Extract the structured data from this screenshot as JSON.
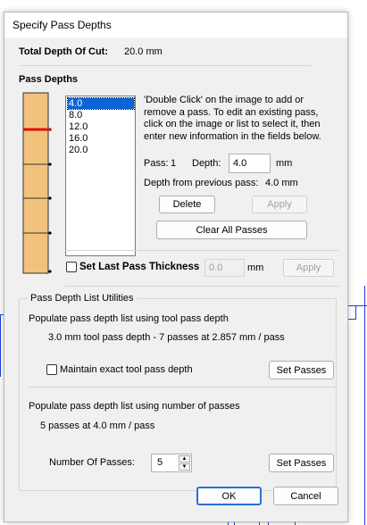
{
  "dialog_title": "Specify Pass Depths",
  "total_depth": {
    "label": "Total Depth Of Cut:",
    "value": "20.0 mm"
  },
  "pass_depths_heading": "Pass Depths",
  "instructions": [
    "'Double Click' on the image to add or",
    "remove a pass. To edit an existing pass,",
    "click on the image or list to select it, then",
    "enter new information in the fields below."
  ],
  "passes": [
    "4.0",
    "8.0",
    "12.0",
    "16.0",
    "20.0"
  ],
  "selected_pass_index": 0,
  "pass_editor": {
    "pass_label": "Pass:",
    "pass_number": "1",
    "depth_label": "Depth:",
    "depth_value": "4.0",
    "depth_unit": "mm",
    "from_prev_label": "Depth from previous pass:",
    "from_prev_value": "4.0 mm"
  },
  "buttons": {
    "delete": "Delete",
    "apply": "Apply",
    "clear_all": "Clear All Passes",
    "apply_last": "Apply",
    "set_passes_1": "Set Passes",
    "set_passes_2": "Set Passes",
    "ok": "OK",
    "cancel": "Cancel"
  },
  "last_pass": {
    "label": "Set Last Pass Thickness",
    "value": "0.0",
    "unit": "mm"
  },
  "utilities": {
    "group_label": "Pass Depth List Utilities",
    "tool_heading": "Populate pass depth list using tool pass depth",
    "tool_summary": "3.0 mm tool pass depth - 7 passes at 2.857 mm / pass",
    "maintain_label": "Maintain exact tool pass depth",
    "num_heading": "Populate pass depth list using number of passes",
    "num_summary": "5 passes at 4.0 mm / pass",
    "num_label": "Number Of Passes:",
    "num_value": "5"
  },
  "colors": {
    "wood": "#f2c27d",
    "pass_marker": "#e01010",
    "selection": "#0a64d8",
    "background_lines": "#1f3fd8"
  }
}
